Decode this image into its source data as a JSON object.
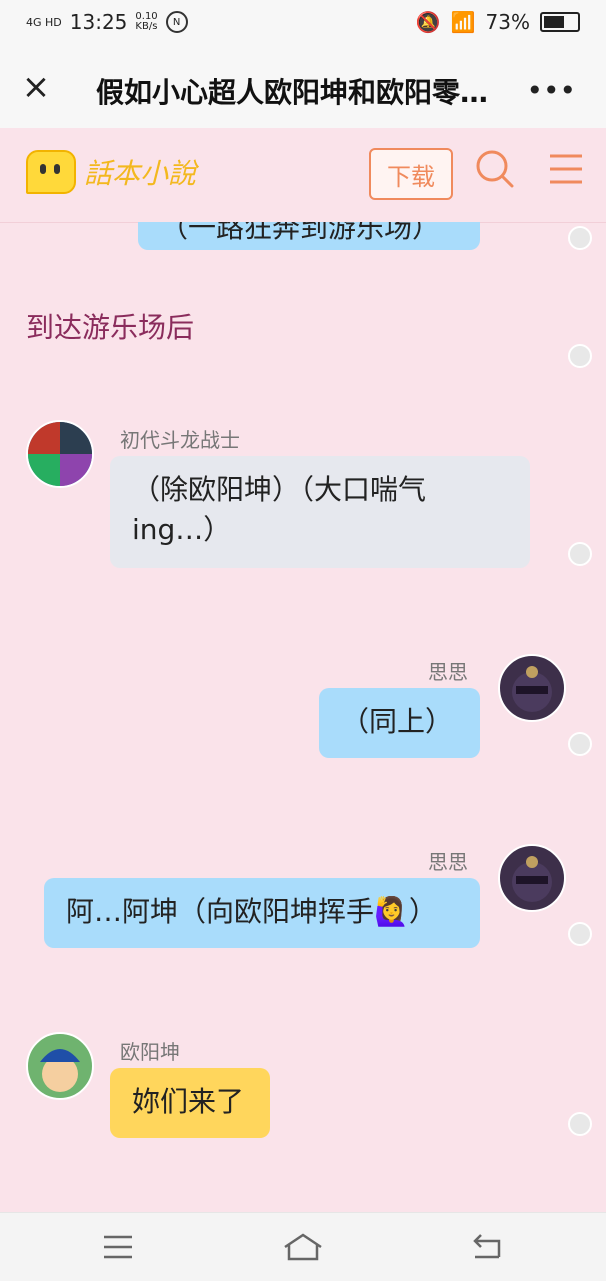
{
  "status": {
    "network": "4G HD",
    "time": "13:25",
    "speed_value": "0.10",
    "speed_unit": "KB/s",
    "nfc_label": "N",
    "battery": "73%",
    "battery_level": 0.73
  },
  "header": {
    "title": "假如小心超人欧阳坤和欧阳零…",
    "close_icon": "close-icon",
    "more_icon": "more-icon"
  },
  "site": {
    "logo_text": "話本小說",
    "download_label": "下载"
  },
  "chat": {
    "partial_bubble": "（一路狂奔到游乐场）",
    "narration": "到达游乐场后",
    "messages": [
      {
        "sender": "初代斗龙战士",
        "text": "（除欧阳坤）（大口喘气ing…）",
        "side": "left",
        "color": "#e6e8ee"
      },
      {
        "sender": "思思",
        "text": "（同上）",
        "side": "right",
        "color": "#a9dcfb"
      },
      {
        "sender": "思思",
        "text": "阿…阿坤（向欧阳坤挥手🙋‍♀️）",
        "side": "right",
        "color": "#a9dcfb"
      },
      {
        "sender": "欧阳坤",
        "text": "妳们来了",
        "side": "left",
        "color": "#ffd65c"
      }
    ]
  }
}
